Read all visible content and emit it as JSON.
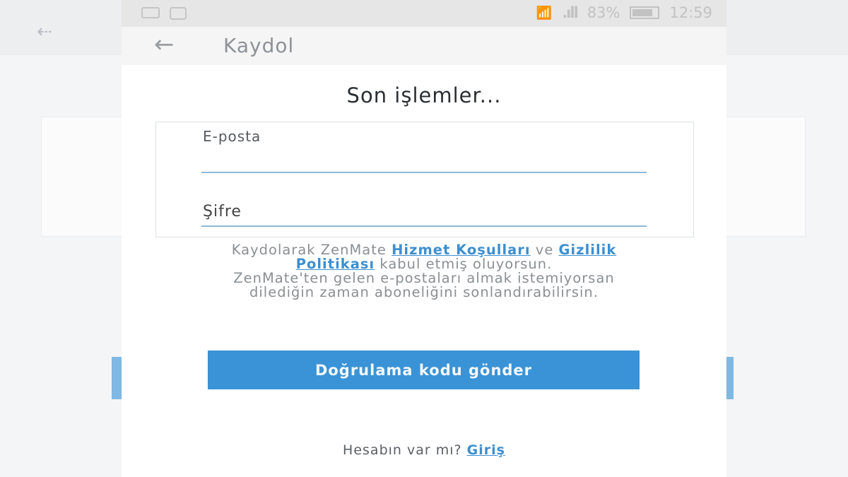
{
  "status_bar": {
    "battery": "83%",
    "battery_level": 0.83,
    "time": "12:59",
    "icons": [
      "message-icon",
      "briefcase-icon",
      "wifi-icon",
      "signal-icon",
      "battery-icon"
    ]
  },
  "app_bar": {
    "back_icon": "arrow-left-icon",
    "back_glyph": "←",
    "title": "Kaydol"
  },
  "main": {
    "heading": "Son işlemler...",
    "email_label": "E-posta",
    "email_value": "",
    "password_label": "Şifre",
    "password_value": "",
    "terms_prefix": "Kaydolarak ZenMate ",
    "terms_link": "Hizmet Koşulları",
    "terms_middle": " ve ",
    "privacy_link": "Gizlilik Politikası",
    "terms_suffix": " kabul etmiş oluyorsun.",
    "unsubscribe_note": "ZenMate'ten gelen e-postaları almak istemiyorsan dilediğin zaman aboneliğini sonlandırabilirsin.",
    "send_button": "Doğrulama kodu gönder",
    "login_prompt": "Hesabın var mı? ",
    "login_link": "Giriş"
  },
  "colors": {
    "accent": "#3a93d6",
    "link": "#3d8fcf",
    "underline": "#8fb9dc",
    "status_bar_bg": "#e6e6e6"
  }
}
